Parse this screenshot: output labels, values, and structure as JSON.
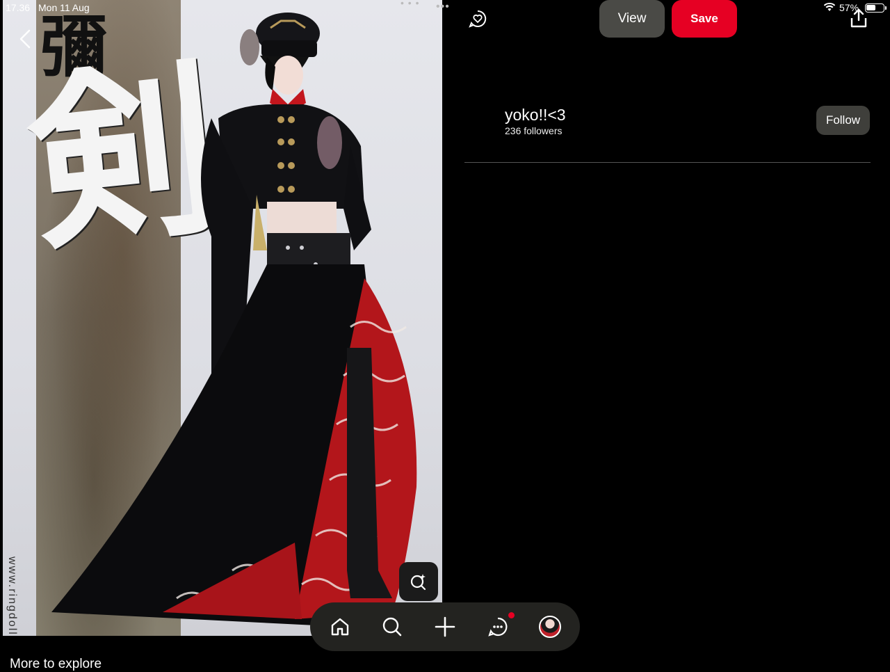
{
  "status_bar": {
    "time": "17.36",
    "date": "Mon 11 Aug",
    "battery_percent": "57%",
    "battery_level": 0.57
  },
  "pin_image": {
    "kanji_top": "彌",
    "kanji_main": "剣",
    "watermark": "www.ringdoll.com"
  },
  "header": {
    "view_label": "View",
    "save_label": "Save"
  },
  "creator": {
    "name": "yoko!!<3",
    "followers": "236 followers",
    "follow_label": "Follow"
  },
  "more_to_explore": "More to explore",
  "colors": {
    "accent_red": "#e60023",
    "button_gray": "#4a4a46",
    "nav_bg": "#232320"
  },
  "bottom_nav": {
    "items": [
      "home-icon",
      "search-icon",
      "plus-icon",
      "messages-icon",
      "profile-avatar"
    ]
  }
}
